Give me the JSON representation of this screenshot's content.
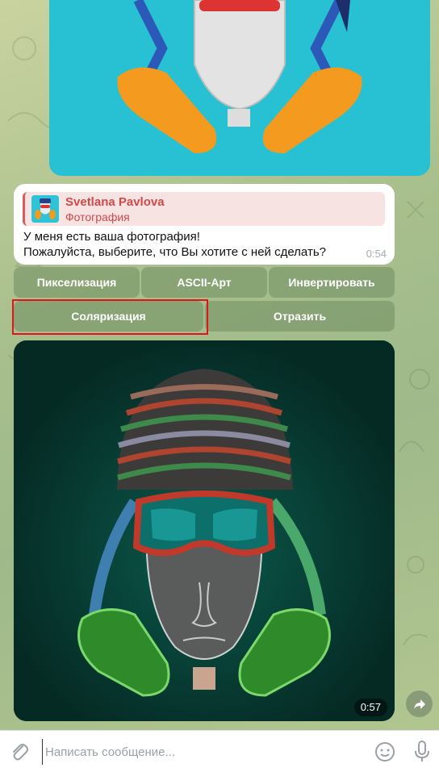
{
  "reply": {
    "name": "Svetlana Pavlova",
    "subtitle": "Фотография"
  },
  "message": {
    "line1": "У меня есть ваша фотография!",
    "line2": "Пожалуйста, выберите, что Вы хотите с ней сделать?",
    "time": "0:54"
  },
  "keyboard": {
    "row1": [
      "Пикселизация",
      "ASCII-Арт",
      "Инвертировать"
    ],
    "row2": [
      "Соляризация",
      "Отразить"
    ]
  },
  "photo": {
    "time": "0:57"
  },
  "composer": {
    "placeholder": "Написать сообщение..."
  },
  "icons": {
    "attach": "paperclip-icon",
    "emoji": "smiley-icon",
    "mic": "microphone-icon",
    "forward": "share-arrow-icon"
  },
  "colors": {
    "accent_name": "#d04a4a",
    "highlight": "#e3131d",
    "button_bg": "#708c60"
  }
}
